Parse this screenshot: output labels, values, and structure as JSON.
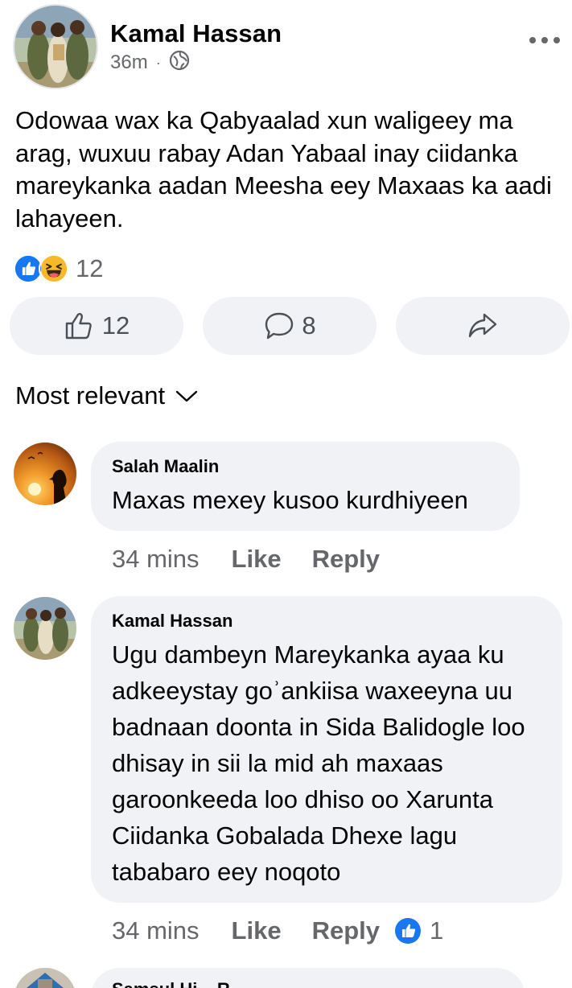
{
  "post": {
    "author": "Kamal Hassan",
    "time": "36m",
    "separator": "·",
    "text": "Odowaa wax ka Qabyaalad xun waligeey ma arag, wuxuu rabay Adan Yabaal inay ciidanka mareykanka aadan Meesha eey Maxaas ka aadi lahayeen.",
    "reaction_count": "12"
  },
  "actions": {
    "like_count": "12",
    "comment_count": "8"
  },
  "filter": {
    "label": "Most relevant"
  },
  "comments": [
    {
      "author": "Salah Maalin",
      "text": "Maxas mexey kusoo kurdhiyeen",
      "time": "34 mins",
      "like_label": "Like",
      "reply_label": "Reply"
    },
    {
      "author": "Kamal Hassan",
      "text": "Ugu dambeyn Mareykanka ayaa ku adkeeystay goʾankiisa waxeeyna uu badnaan doonta in Sida Balidogle loo dhisay in sii la mid ah maxaas garoonkeeda loo dhiso oo Xarunta Ciidanka Gobalada Dhexe lagu tababaro eey noqoto",
      "time": "34 mins",
      "like_label": "Like",
      "reply_label": "Reply",
      "reaction_count": "1"
    }
  ],
  "next_comment": {
    "author_partial": "Samsul Hi... R..."
  },
  "icons": {
    "privacy": "globe-icon",
    "more": "more-dots-icon",
    "like_reaction": "like-reaction-icon",
    "haha_reaction": "haha-reaction-icon",
    "like": "thumbs-up-icon",
    "comment": "comment-bubble-icon",
    "share": "share-arrow-icon",
    "dropdown": "chevron-down-icon"
  },
  "colors": {
    "like_blue": "#1877f2",
    "haha_yellow": "#f7b928",
    "bubble_bg": "#f0f2f5",
    "secondary_text": "#65676b"
  }
}
